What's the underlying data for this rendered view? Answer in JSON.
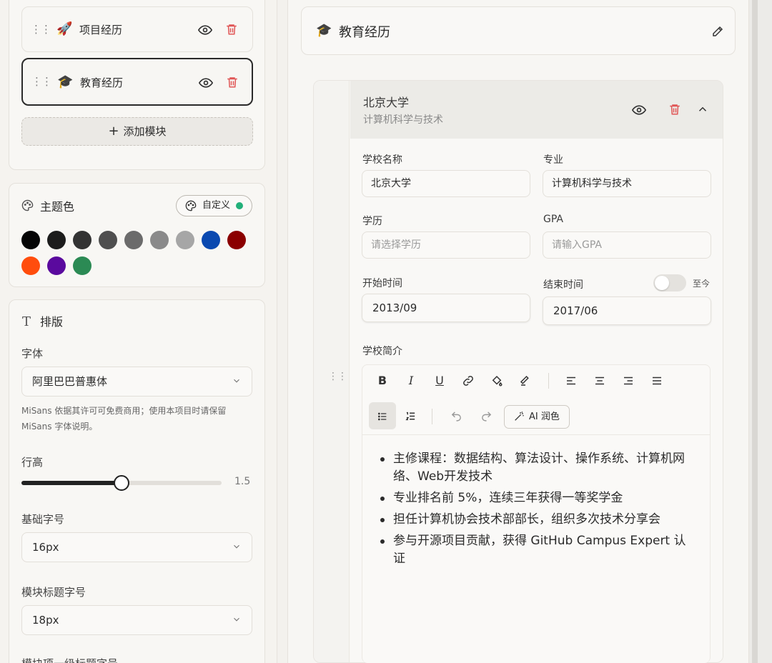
{
  "modules": {
    "items": [
      {
        "icon": "rocket-icon",
        "label": "项目经历"
      },
      {
        "icon": "graduation-cap-icon",
        "label": "教育经历"
      }
    ],
    "add_label": "添加模块"
  },
  "theme": {
    "title": "主题色",
    "custom_label": "自定义",
    "custom_dot_color": "#22b07a",
    "swatches": [
      "#050505",
      "#1c1c1c",
      "#333333",
      "#4f4f4f",
      "#6b6b6b",
      "#8a8a8a",
      "#a6a6a6",
      "#0a49b0",
      "#8b0000",
      "#ff4d0d",
      "#5a0a9e",
      "#2b8a54"
    ]
  },
  "typography": {
    "title": "排版",
    "font_label": "字体",
    "font_value": "阿里巴巴普惠体",
    "font_hint": "MiSans 依据其许可可免费商用；使用本项目时请保留 MiSans 字体说明。",
    "line_height_label": "行高",
    "line_height_value": "1.5",
    "line_height_fraction": 0.5,
    "base_size_label": "基础字号",
    "base_size_value": "16px",
    "module_title_size_label": "模块标题字号",
    "module_title_size_value": "18px",
    "module_item_size_label": "模块项一级标题字号"
  },
  "section": {
    "title": "教育经历"
  },
  "entry": {
    "school": "北京大学",
    "major": "计算机科学与技术",
    "school_name_label": "学校名称",
    "school_name_value": "北京大学",
    "major_label": "专业",
    "major_value": "计算机科学与技术",
    "degree_label": "学历",
    "degree_placeholder": "请选择学历",
    "gpa_label": "GPA",
    "gpa_placeholder": "请输入GPA",
    "start_label": "开始时间",
    "start_value": "2013/09",
    "end_label": "结束时间",
    "end_value": "2017/06",
    "present_label": "至今",
    "intro_label": "学校简介",
    "ai_label": "AI 润色",
    "bullets": [
      "主修课程：数据结构、算法设计、操作系统、计算机网络、Web开发技术",
      "专业排名前 5%，连续三年获得一等奖学金",
      "担任计算机协会技术部部长，组织多次技术分享会",
      "参与开源项目贡献，获得 GitHub Campus Expert 认证"
    ]
  }
}
